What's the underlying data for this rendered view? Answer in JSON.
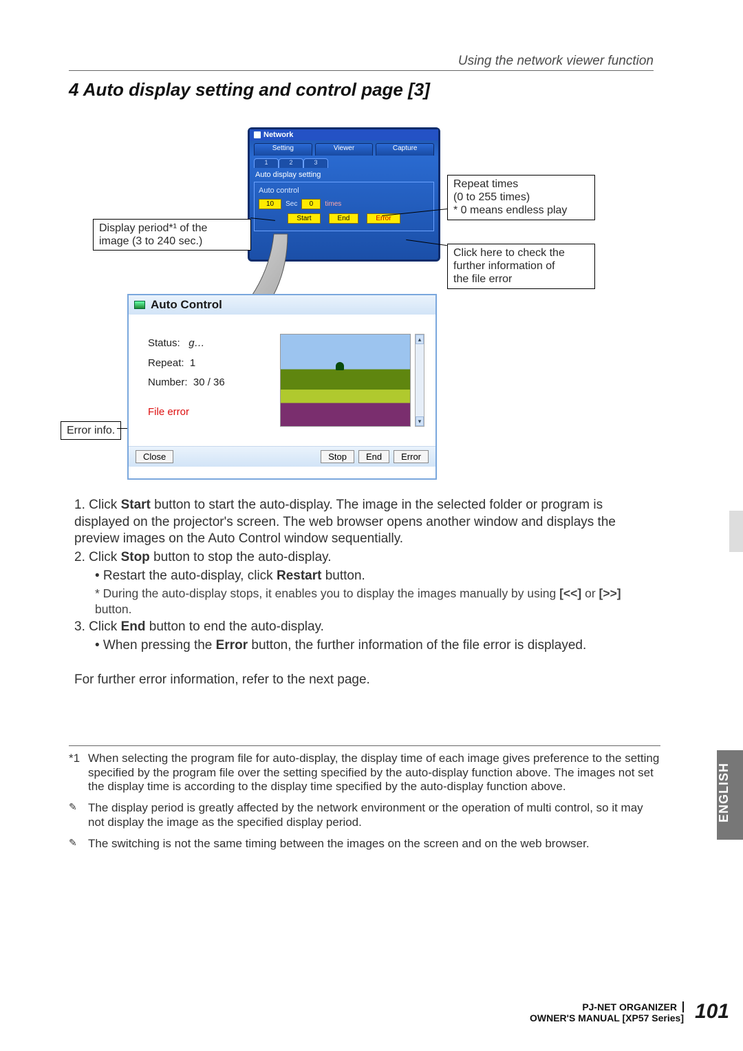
{
  "header": {
    "breadcrumb": "Using the network viewer function",
    "section_number": "4",
    "section_title": "Auto display setting and control page [3]"
  },
  "network_window": {
    "title": "Network",
    "tabs_main": [
      "Setting",
      "Viewer",
      "Capture"
    ],
    "tabs_sub": [
      "1",
      "2",
      "3"
    ],
    "panel_title": "Auto display  setting",
    "sub_label": "Auto control",
    "sec_value": "10",
    "sec_unit": "Sec",
    "times_value": "0",
    "times_unit": "times",
    "buttons": {
      "start": "Start",
      "end": "End",
      "error": "Error"
    }
  },
  "callouts": {
    "display_period": "Display period*¹ of the\nimage (3 to 240 sec.)",
    "repeat_times": "Repeat times\n(0 to 255 times)\n* 0 means endless play",
    "click_here": "Click here to check the\nfurther information of\nthe file error",
    "error_info": "Error info."
  },
  "auto_control": {
    "title": "Auto Control",
    "status_label": "Status:",
    "status_icon": "g…",
    "repeat_label": "Repeat:",
    "repeat_value": "1",
    "number_label": "Number:",
    "number_value": "30 / 36",
    "file_error": "File error",
    "buttons": {
      "close": "Close",
      "stop": "Stop",
      "end": "End",
      "error": "Error"
    }
  },
  "instructions": {
    "i1_pre": "1. Click ",
    "i1_bold": "Start",
    "i1_post": " button to start the auto-display. The image in the selected folder or program is displayed on the projector's screen. The web browser opens another window and displays the preview images on the Auto Control window sequentially.",
    "i2_pre": "2. Click ",
    "i2_bold": "Stop",
    "i2_post": " button to stop the auto-display.",
    "i2s_pre": "• Restart the auto-display, click ",
    "i2s_bold": "Restart",
    "i2s_post": " button.",
    "i2n_pre": "* During the auto-display stops, it enables you to display the images manually by using ",
    "i2n_b1": "[<<]",
    "i2n_mid": " or ",
    "i2n_b2": "[>>]",
    "i2n_post": " button.",
    "i3_pre": "3. Click ",
    "i3_bold": "End",
    "i3_post": " button to end the auto-display.",
    "i3s_pre": "• When pressing the ",
    "i3s_bold": "Error",
    "i3s_post": " button, the further information of the file error is displayed.",
    "para": "For further error information, refer to the next page."
  },
  "footnotes": {
    "f1_mark": "*1",
    "f1": "When selecting the program file for auto-display, the display time of each image gives preference to the setting specified by the program file over the setting specified by the auto-display function above. The images not set the display time is according to the display time specified by the auto-display function above.",
    "f2": "The display period is greatly affected by the network environment or the operation of multi control, so it may not display the image as the specified display period.",
    "f3": "The switching is not the same timing between the images on the screen and on the web browser."
  },
  "footer": {
    "product": "PJ-NET ORGANIZER",
    "manual": "OWNER'S MANUAL [XP57 Series]",
    "page": "101",
    "lang": "ENGLISH"
  }
}
